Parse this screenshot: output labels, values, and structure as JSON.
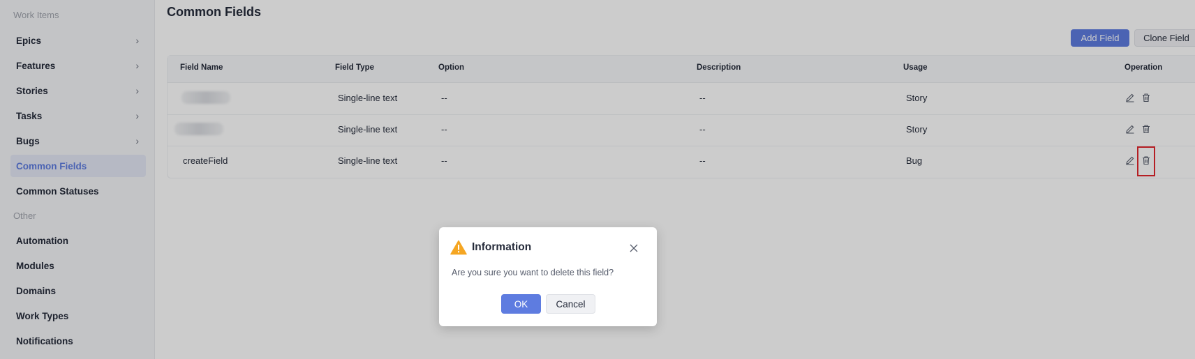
{
  "sidebar": {
    "group_work_items": "Work Items",
    "items": [
      {
        "label": "Epics",
        "chevron": true
      },
      {
        "label": "Features",
        "chevron": true
      },
      {
        "label": "Stories",
        "chevron": true
      },
      {
        "label": "Tasks",
        "chevron": true
      },
      {
        "label": "Bugs",
        "chevron": true
      },
      {
        "label": "Common Fields",
        "active": true
      },
      {
        "label": "Common Statuses"
      }
    ],
    "group_other": "Other",
    "other_items": [
      "Automation",
      "Modules",
      "Domains",
      "Work Types",
      "Notifications"
    ]
  },
  "page": {
    "title": "Common Fields",
    "add_field": "Add Field",
    "clone_field": "Clone Field"
  },
  "table": {
    "columns": [
      "Field Name",
      "Field Type",
      "Option",
      "Description",
      "Usage",
      "Operation"
    ],
    "rows": [
      {
        "name": "",
        "type": "Single-line text",
        "option": "--",
        "description": "--",
        "usage": "Story"
      },
      {
        "name": "",
        "type": "Single-line text",
        "option": "--",
        "description": "--",
        "usage": "Story"
      },
      {
        "name": "createField",
        "type": "Single-line text",
        "option": "--",
        "description": "--",
        "usage": "Bug"
      }
    ]
  },
  "dialog": {
    "title": "Information",
    "message": "Are you sure you want to delete this field?",
    "ok": "OK",
    "cancel": "Cancel"
  },
  "colors": {
    "brand": "#5e7ce0",
    "highlight": "#e3262c",
    "warning": "#f5a623"
  }
}
